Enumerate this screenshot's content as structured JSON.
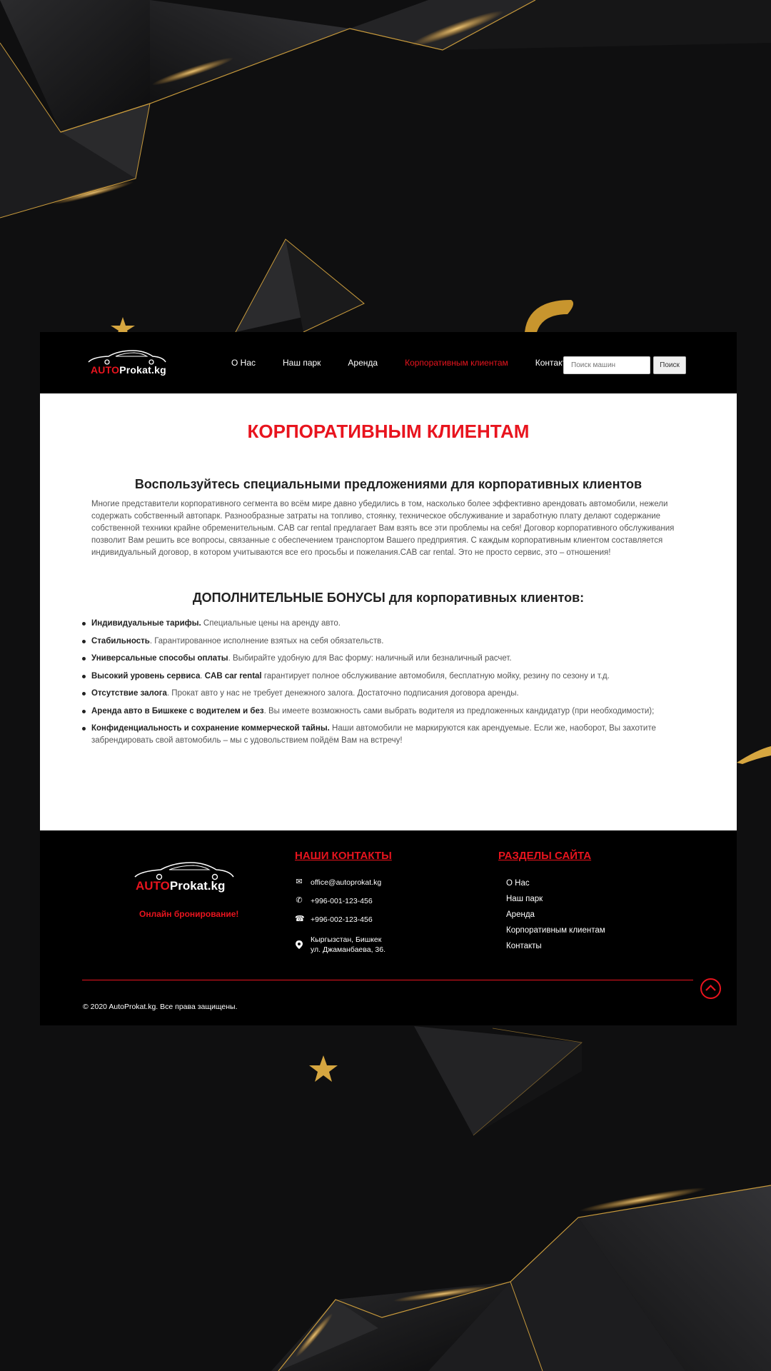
{
  "brand": {
    "logo_part1": "AUTO",
    "logo_part2": "Prokat.kg"
  },
  "nav": {
    "items": [
      {
        "label": "О Нас",
        "active": false
      },
      {
        "label": "Наш парк",
        "active": false
      },
      {
        "label": "Аренда",
        "active": false
      },
      {
        "label": "Корпоративным клиентам",
        "active": true
      },
      {
        "label": "Контакты",
        "active": false
      }
    ],
    "search_placeholder": "Поиск машин",
    "search_button": "Поиск"
  },
  "main": {
    "title": "КОРПОРАТИВНЫМ КЛИЕНТАМ",
    "subtitle": "Воспользуйтесь специальными предложениями для корпоративных клиентов",
    "paragraph": "Многие представители корпоративного сегмента во всём мире давно убедились в том, насколько более эффективно арендовать автомобили, нежели содержать собственный автопарк. Разнообразные затраты на топливо, стоянку, техническое обслуживание и заработную плату делают содержание собственной техники крайне обременительным. CAB car rental предлагает Вам взять все эти проблемы на себя! Договор корпоративного обслуживания позволит Вам решить все вопросы, связанные с обеспечением транспортом Вашего предприятия. С каждым корпоративным клиентом составляется индивидуальный договор, в котором учитываются все его просьбы и пожелания.CAB car rental. Это не просто сервис, это – отношения!",
    "bonus_title": "ДОПОЛНИТЕЛЬНЫЕ БОНУСЫ для корпоративных клиентов:",
    "bonuses": [
      {
        "bold": "Индивидуальные тарифы.",
        "text": " Специальные цены на аренду авто."
      },
      {
        "bold": "Стабильность",
        "text": ". Гарантированное исполнение взятых на себя обязательств."
      },
      {
        "bold": "Универсальные способы оплаты",
        "text": ". Выбирайте удобную для Вас форму: наличный или безналичный расчет."
      },
      {
        "bold": "Высокий уровень сервиса",
        "text": ". ",
        "bold2": "CAB car rental",
        "text2": " гарантирует полное обслуживание автомобиля, бесплатную мойку, резину по сезону и т.д."
      },
      {
        "bold": "Отсутствие залога",
        "text": ". Прокат авто у нас не требует денежного залога. Достаточно подписания договора аренды."
      },
      {
        "bold": "Аренда авто в Бишкеке с водителем и без",
        "text": ". Вы имеете возможность сами выбрать водителя из предложенных кандидатур (при необходимости);"
      },
      {
        "bold": "Конфиденциальность и сохранение коммерческой тайны.",
        "text": " Наши автомобили не маркируются как арендуемые. Если же, наоборот, Вы захотите забрендировать свой автомобиль – мы с удовольствием пойдём Вам на встречу!"
      }
    ]
  },
  "footer": {
    "online_booking": "Онлайн бронирование!",
    "contacts_title": "НАШИ КОНТАКТЫ",
    "email": "office@autoprokat.kg",
    "phone1": "+996-001-123-456",
    "phone2": "+996-002-123-456",
    "address_line1": "Кыргызстан, Бишкек",
    "address_line2": "ул. Джаманбаева, 36.",
    "sections_title": "РАЗДЕЛЫ САЙТА",
    "sections": [
      "О Нас",
      "Наш парк",
      "Аренда",
      "Корпоративным клиентам",
      "Контакты"
    ],
    "copyright": "© 2020 AutoProkat.kg. Все права защищены."
  },
  "colors": {
    "accent": "#e8141e",
    "gold": "#d6a640",
    "header_bg": "#000000",
    "page_bg": "#0e0e0f"
  },
  "icons": [
    "up-arrow-icon",
    "mail-icon",
    "phone-icon",
    "landline-icon",
    "location-icon",
    "car-silhouette-icon",
    "star-icon"
  ]
}
